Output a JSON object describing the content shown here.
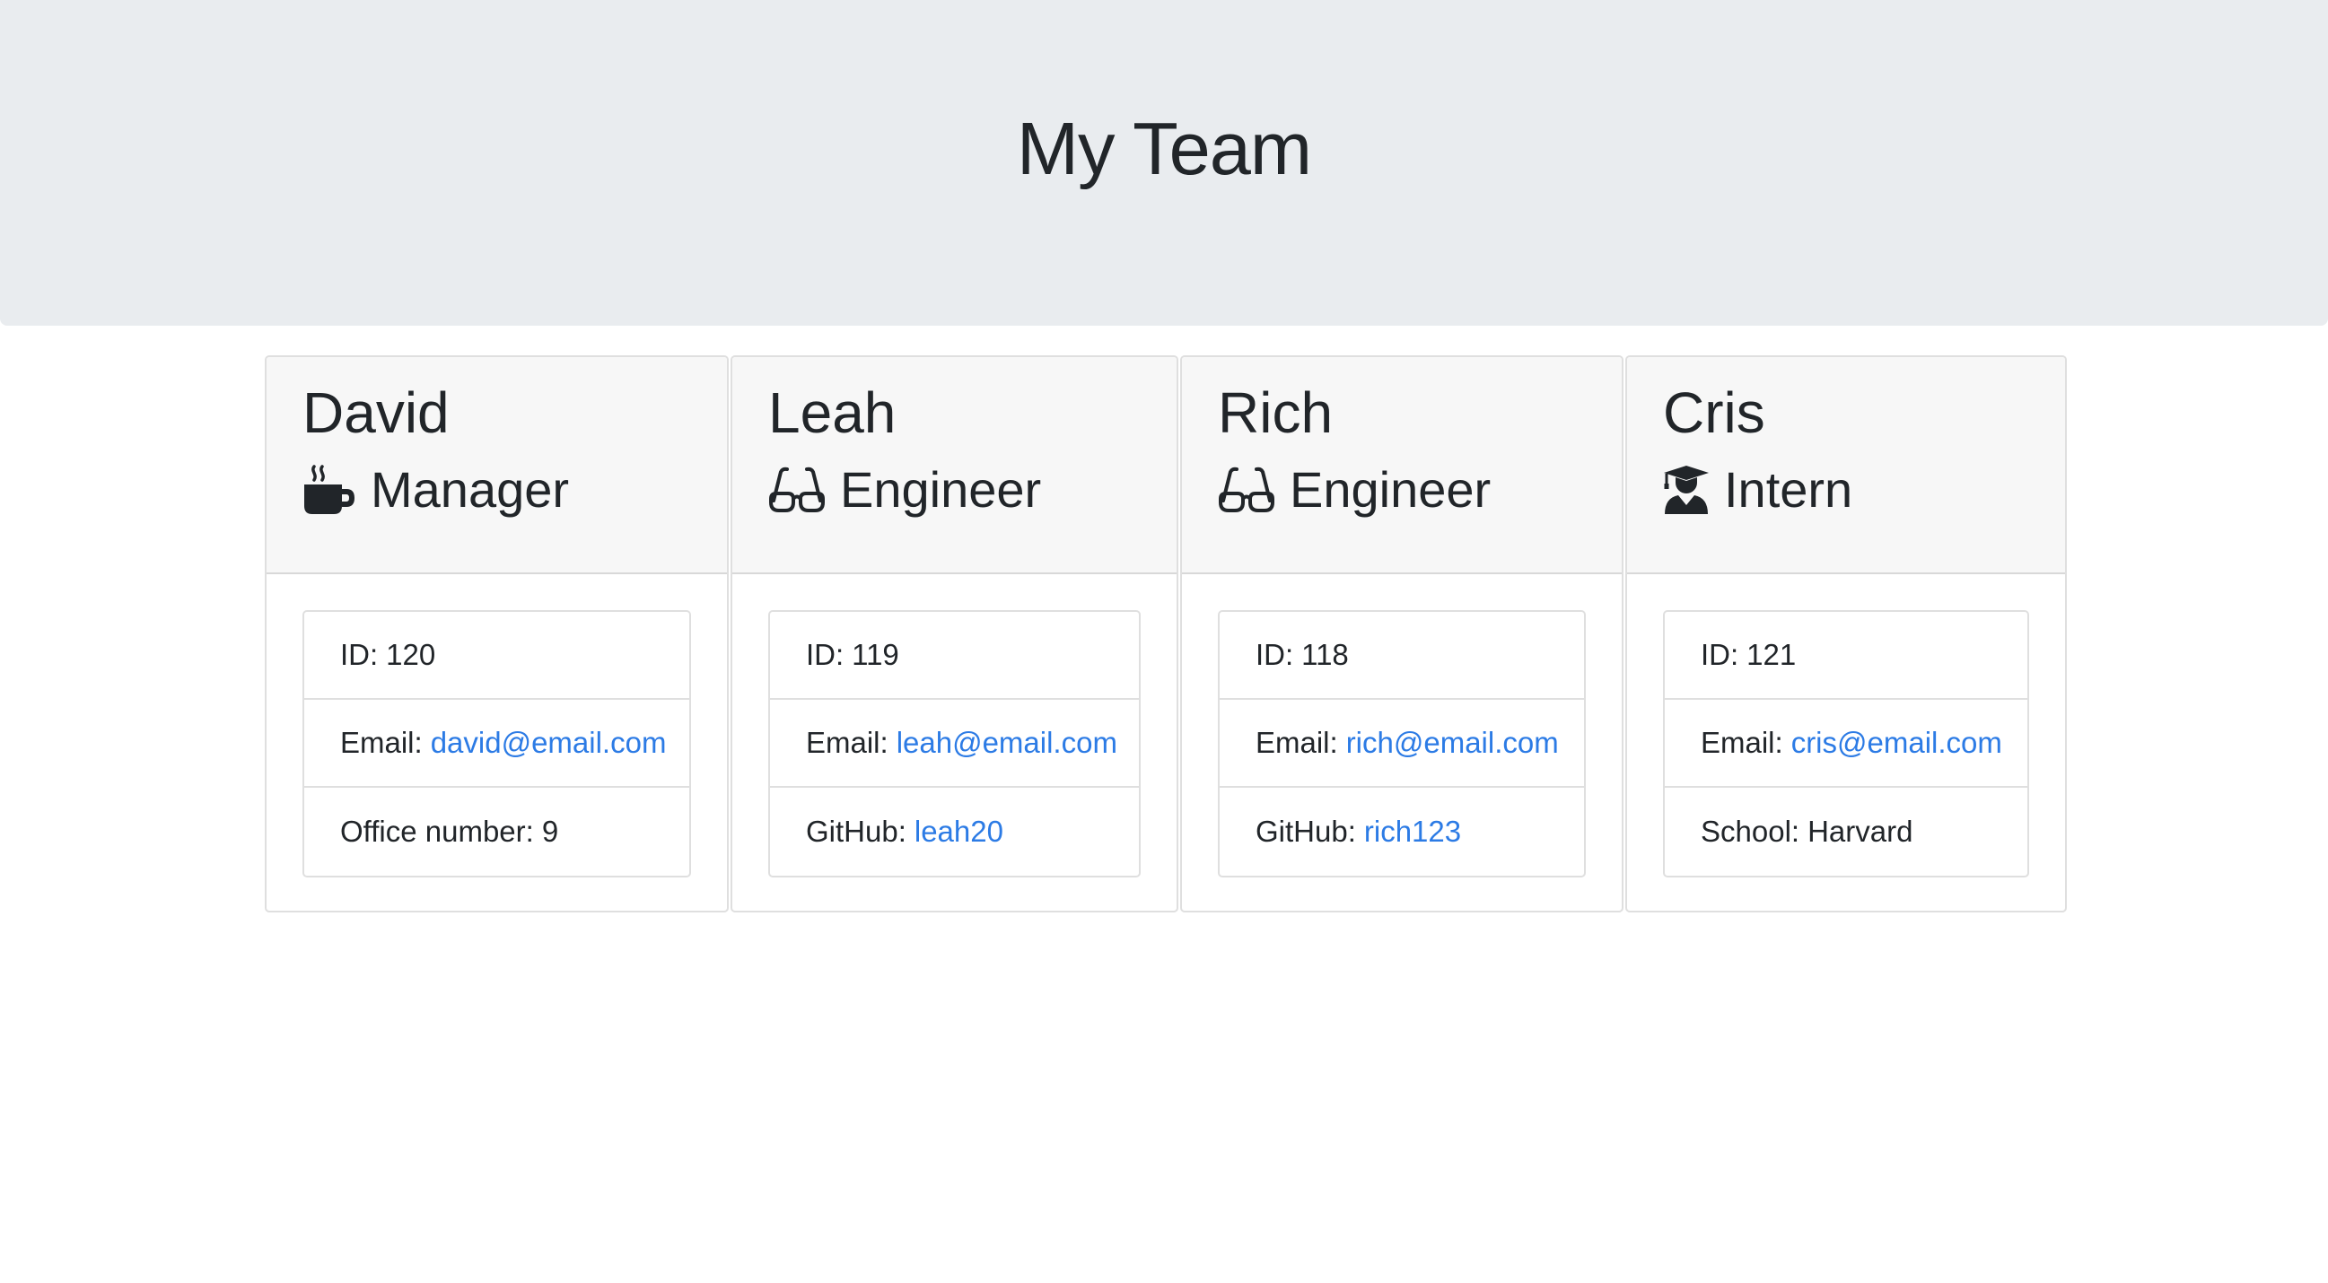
{
  "page": {
    "title": "My Team"
  },
  "team": [
    {
      "name": "David",
      "role": "Manager",
      "icon": "coffee-mug-icon",
      "id_label": "ID:",
      "id_value": "120",
      "email_label": "Email:",
      "email": "david@email.com",
      "extra_label": "Office number:",
      "extra_value": "9",
      "extra_is_link": false
    },
    {
      "name": "Leah",
      "role": "Engineer",
      "icon": "glasses-icon",
      "id_label": "ID:",
      "id_value": "119",
      "email_label": "Email:",
      "email": "leah@email.com",
      "extra_label": "GitHub:",
      "extra_value": "leah20",
      "extra_is_link": true
    },
    {
      "name": "Rich",
      "role": "Engineer",
      "icon": "glasses-icon",
      "id_label": "ID:",
      "id_value": "118",
      "email_label": "Email:",
      "email": "rich@email.com",
      "extra_label": "GitHub:",
      "extra_value": "rich123",
      "extra_is_link": true
    },
    {
      "name": "Cris",
      "role": "Intern",
      "icon": "graduate-icon",
      "id_label": "ID:",
      "id_value": "121",
      "email_label": "Email:",
      "email": "cris@email.com",
      "extra_label": "School:",
      "extra_value": "Harvard",
      "extra_is_link": false
    }
  ],
  "colors": {
    "header_background": "#e9ecef",
    "card_header_background": "#f7f7f7",
    "link": "#2c7be5",
    "text": "#212529"
  }
}
